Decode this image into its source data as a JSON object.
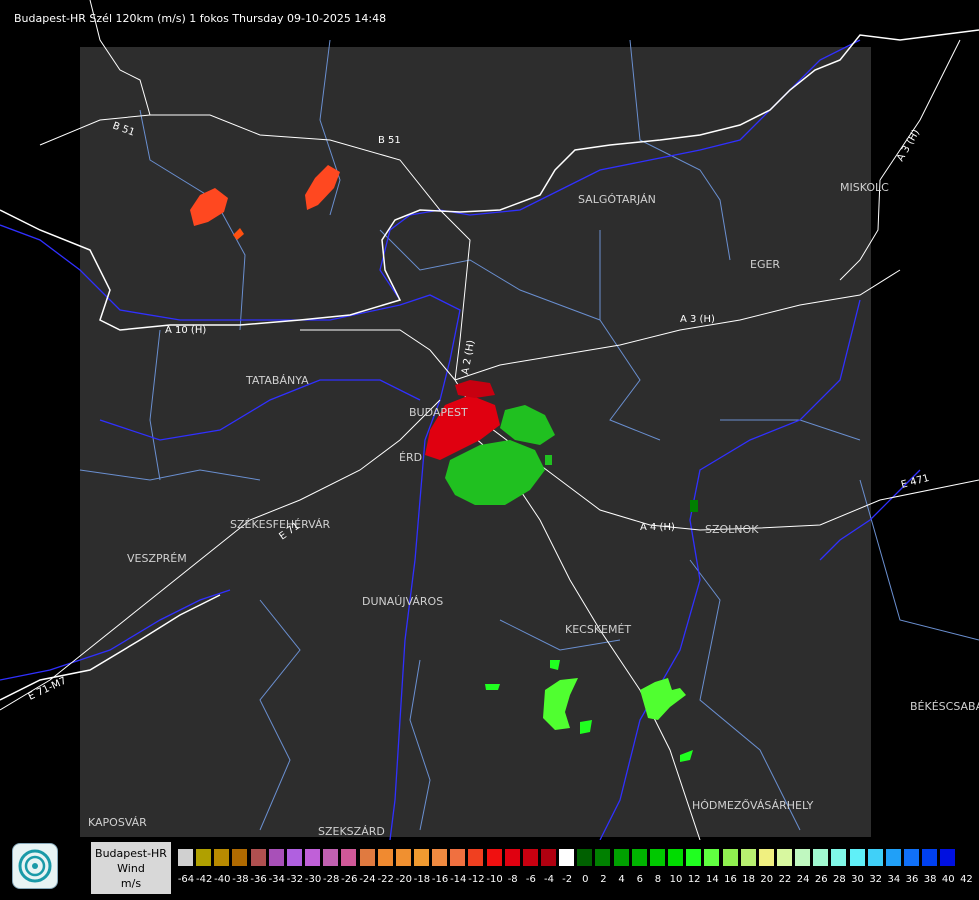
{
  "title": "Budapest-HR Szél 120km (m/s) 1 fokos Thursday 09-10-2025 14:48",
  "cities": [
    {
      "name": "SALGÓTARJÁN"
    },
    {
      "name": "MISKOLC"
    },
    {
      "name": "EGER"
    },
    {
      "name": "TATABÁNYA"
    },
    {
      "name": "BUDAPEST"
    },
    {
      "name": "ÉRD"
    },
    {
      "name": "SZÉKESFEHÉRVÁR"
    },
    {
      "name": "VESZPRÉM"
    },
    {
      "name": "DUNAÚJVÁROS"
    },
    {
      "name": "KECSKEMÉT"
    },
    {
      "name": "SZOLNOK"
    },
    {
      "name": "BÉKÉSCSABA"
    },
    {
      "name": "HÓDMEZŐVÁSÁRHELY"
    },
    {
      "name": "KAPOSVÁR"
    },
    {
      "name": "SZEKSZÁRD"
    }
  ],
  "roads": [
    {
      "label": "B 51"
    },
    {
      "label": "B 51"
    },
    {
      "label": "A 3 (H)"
    },
    {
      "label": "A 3 (H)"
    },
    {
      "label": "A 10 (H)"
    },
    {
      "label": "A 2 (H)"
    },
    {
      "label": "A 4 (H)"
    },
    {
      "label": "E 471"
    },
    {
      "label": "E 71"
    },
    {
      "label": "E 71-M7"
    }
  ],
  "legend": {
    "line1": "Budapest-HR",
    "line2": "Wind",
    "line3": "m/s"
  },
  "scale": {
    "labels": [
      "-64",
      "-42",
      "-40",
      "-38",
      "-36",
      "-34",
      "-32",
      "-30",
      "-28",
      "-26",
      "-24",
      "-22",
      "-20",
      "-18",
      "-16",
      "-14",
      "-12",
      "-10",
      "-8",
      "-6",
      "-4",
      "-2",
      "0",
      "2",
      "4",
      "6",
      "8",
      "10",
      "12",
      "14",
      "16",
      "18",
      "20",
      "22",
      "24",
      "26",
      "28",
      "30",
      "32",
      "34",
      "36",
      "38",
      "40",
      "42"
    ],
    "colors": [
      "#d0d0d0",
      "#b0a000",
      "#b88a00",
      "#b06a00",
      "#b05050",
      "#a850b8",
      "#b060e0",
      "#c060d8",
      "#c060b0",
      "#d05898",
      "#e07a40",
      "#f08a30",
      "#f09030",
      "#f09a30",
      "#f08a40",
      "#f07040",
      "#f04020",
      "#f01010",
      "#e00010",
      "#c80010",
      "#b00010",
      "#ffffff",
      "#006000",
      "#008000",
      "#00a000",
      "#00b400",
      "#00c800",
      "#00dc00",
      "#20ff20",
      "#60ff40",
      "#90f050",
      "#b8f070",
      "#f0f080",
      "#d8f8a0",
      "#c0f8c0",
      "#a0f8d0",
      "#80f8e8",
      "#60f0f8",
      "#40d0f8",
      "#20a0f8",
      "#1070f8",
      "#0040f0",
      "#0010e0"
    ]
  },
  "colors": {
    "map_background": "#2d2d2d",
    "outer_background": "#000000",
    "border_line": "#ffffff",
    "river": "#3030ff",
    "admin_line": "#6a8fd0"
  }
}
